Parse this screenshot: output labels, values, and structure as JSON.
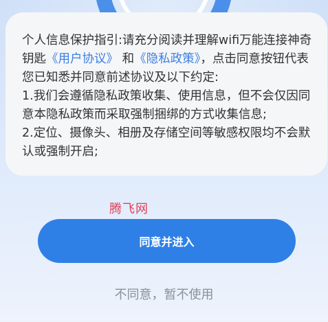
{
  "background": {
    "logo_icon": "wifi-logo-icon"
  },
  "notice": {
    "intro_before": "个人信息保护指引:请充分阅读并理解wifi万能连接神奇钥匙",
    "user_agreement_link": "《用户协议》",
    "and_text": " 和",
    "privacy_policy_link": "《隐私政策》",
    "intro_after": "，点击同意按钮代表您已知悉并同意前述协议及以下约定:",
    "item1": "1.我们会遵循隐私政策收集、使用信息，但不会仅因同意本隐私政策而采取强制捆绑的方式收集信息;",
    "item2": "2.定位、摄像头、相册及存储空间等敏感权限均不会默认或强制开启;"
  },
  "watermark": "腾飞网",
  "buttons": {
    "agree_label": "同意并进入",
    "decline_label": "不同意，暂不使用"
  },
  "colors": {
    "primary": "#2f80e6",
    "link": "#3b7fe0",
    "card_bg": "#f5f6f8",
    "watermark": "#e0405a"
  }
}
